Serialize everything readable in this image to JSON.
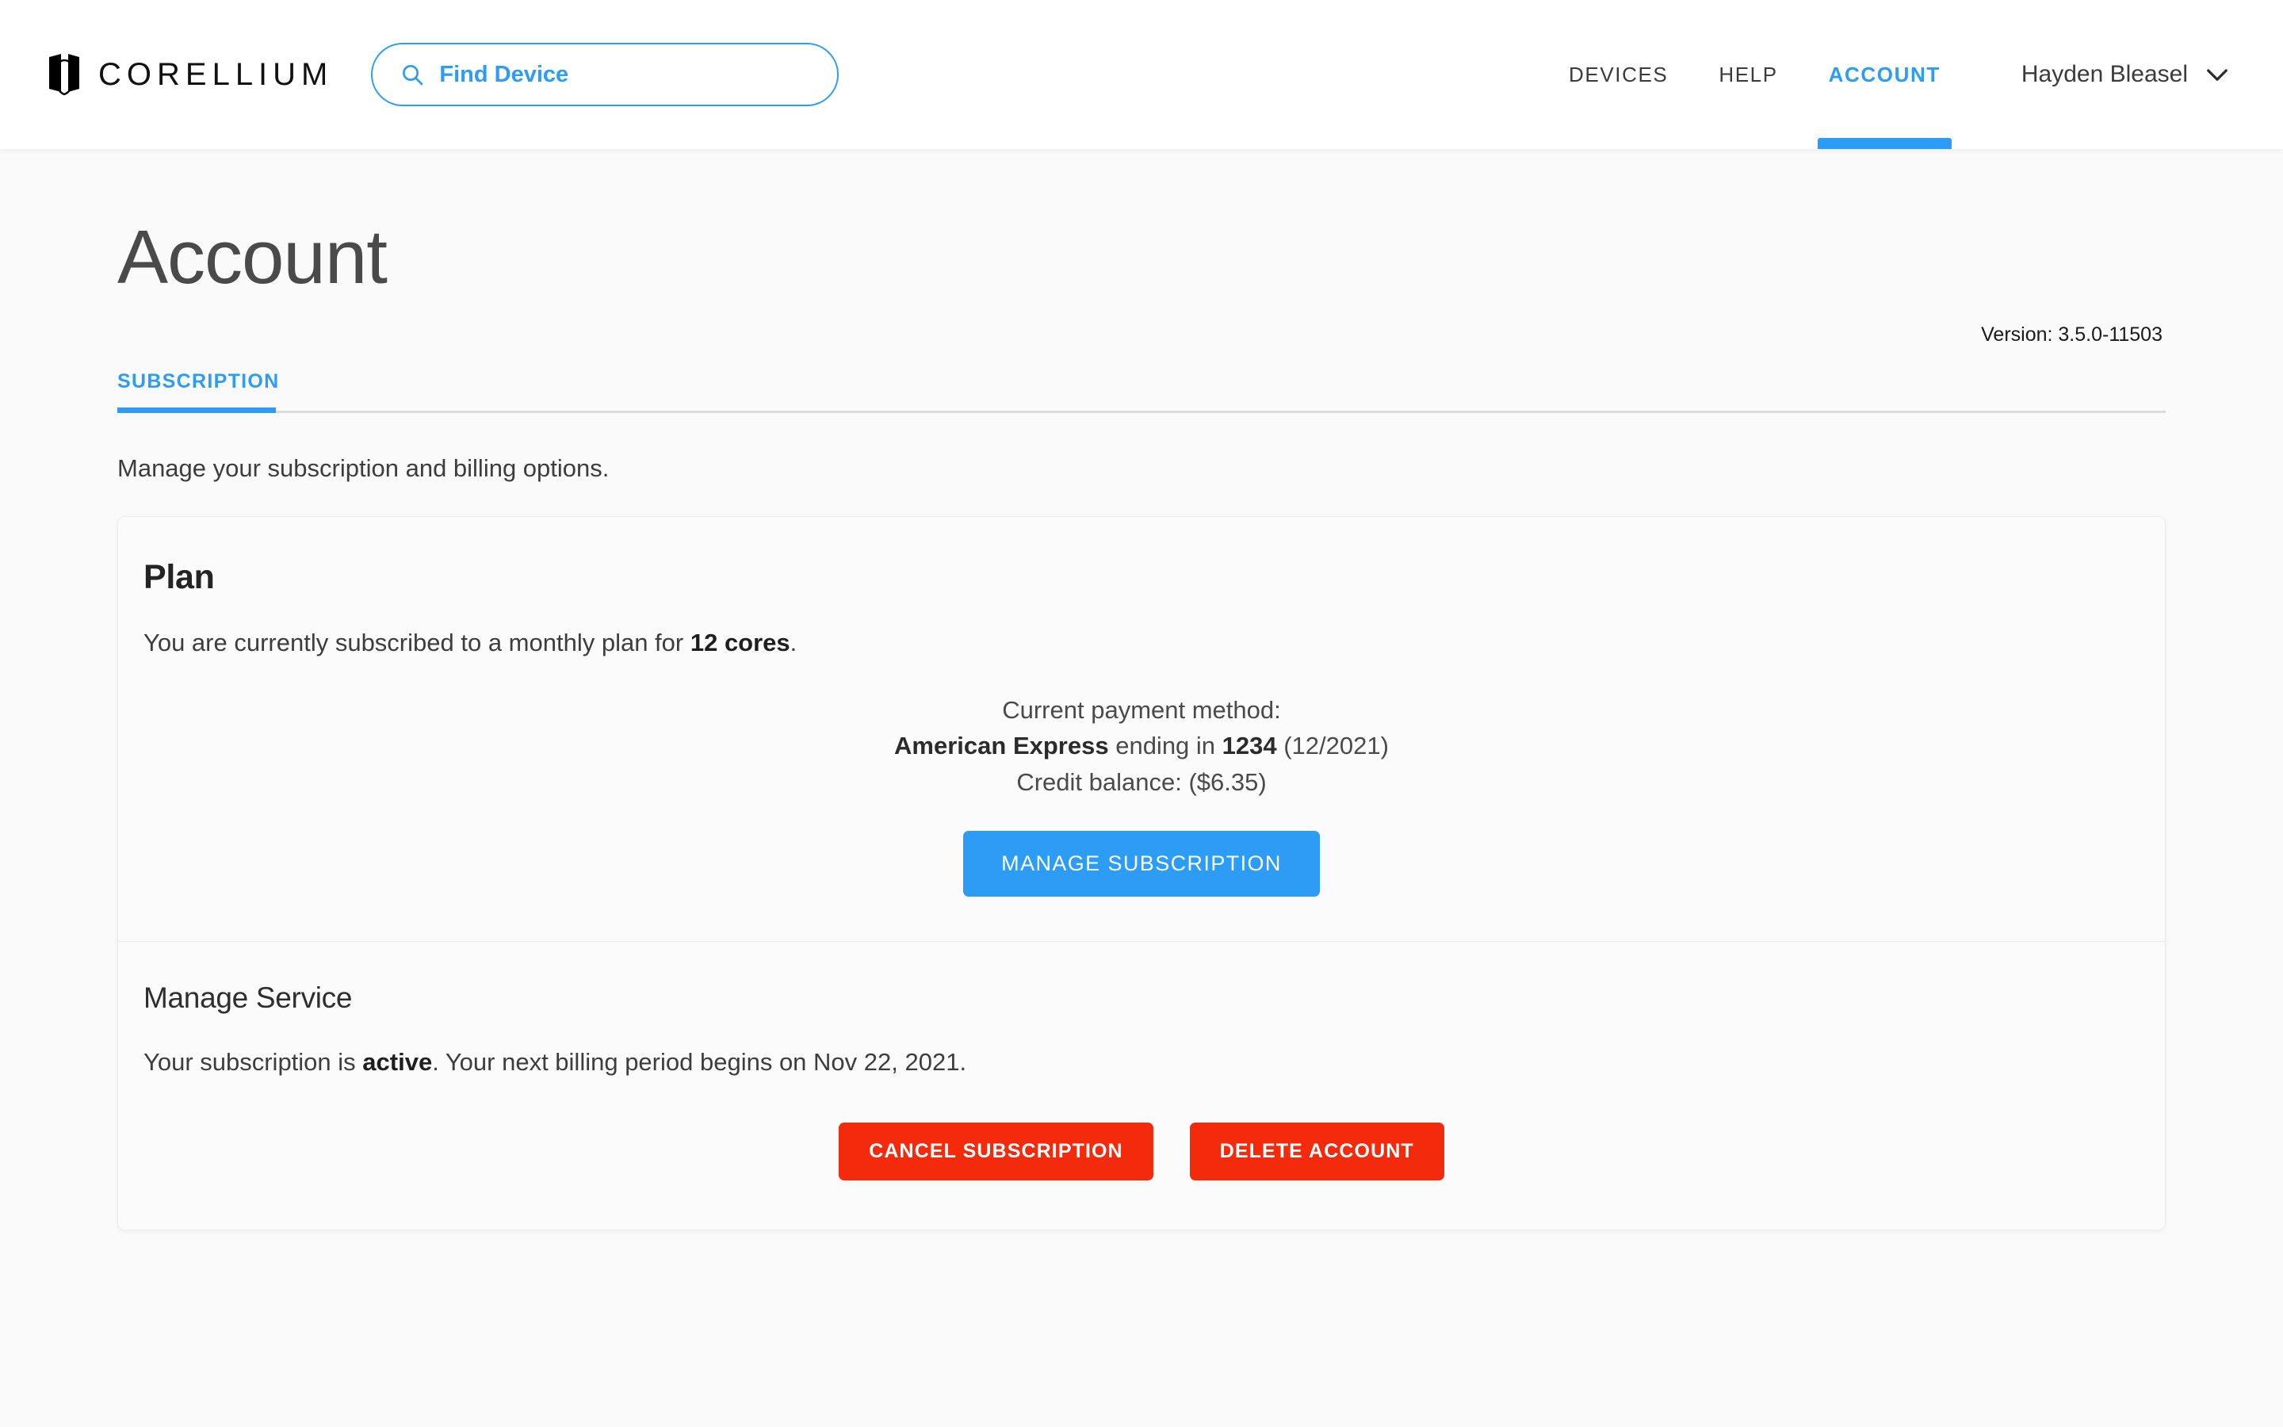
{
  "navbar": {
    "logo_icon": "corellium-logo-icon",
    "brand_name": "CORELLIUM",
    "search": {
      "icon": "search-icon",
      "placeholder": "Find Device",
      "value": ""
    },
    "links": [
      {
        "label": "DEVICES",
        "active": false
      },
      {
        "label": "HELP",
        "active": false
      },
      {
        "label": "ACCOUNT",
        "active": true
      }
    ],
    "user": {
      "name": "Hayden Bleasel",
      "chevron_icon": "chevron-down-icon"
    }
  },
  "page": {
    "title": "Account",
    "version": "Version: 3.5.0-11503",
    "tabs": [
      {
        "label": "SUBSCRIPTION",
        "active": true
      }
    ],
    "subtitle": "Manage your subscription and billing options."
  },
  "plan_card": {
    "title": "Plan",
    "plan_text_prefix": "You are currently subscribed to a monthly plan for ",
    "plan_cores": "12 cores",
    "plan_text_suffix": ".",
    "payment_label": "Current payment method:",
    "card_brand": "American Express",
    "card_middle": " ending in ",
    "card_last4": "1234",
    "card_expiry": " (12/2021)",
    "credit_balance": "Credit balance: ($6.35)",
    "manage_button": "MANAGE SUBSCRIPTION"
  },
  "manage_service": {
    "title": "Manage Service",
    "status_prefix": "Your subscription is ",
    "status_value": "active",
    "status_suffix": ". Your next billing period begins on Nov 22, 2021.",
    "cancel_button": "CANCEL SUBSCRIPTION",
    "delete_button": "DELETE ACCOUNT"
  },
  "colors": {
    "accent": "#2c9cf4",
    "danger": "#f42a0d",
    "background": "#fafafa",
    "card": "#fbfbfb",
    "text": "#3d3d3d"
  }
}
